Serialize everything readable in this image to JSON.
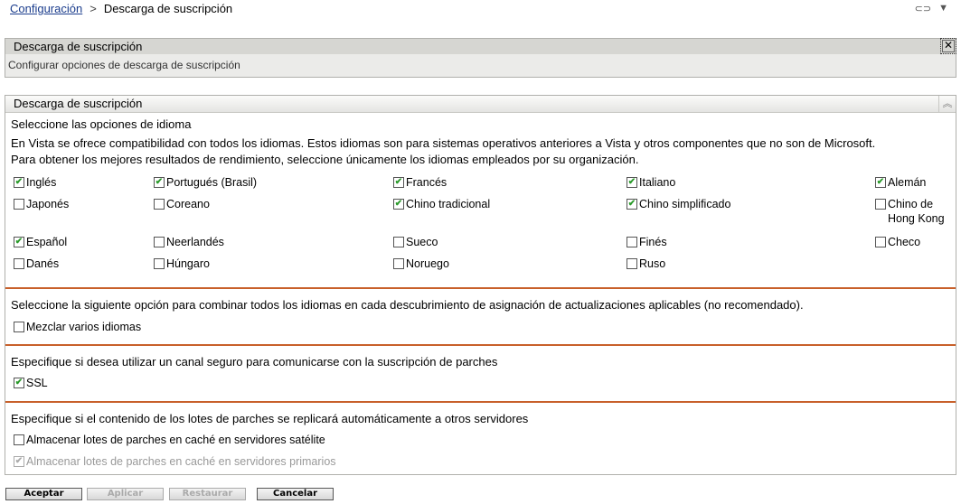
{
  "breadcrumb": {
    "parent": "Configuración",
    "current": "Descarga de suscripción"
  },
  "panel1": {
    "title": "Descarga de suscripción",
    "description": "Configurar opciones de descarga de suscripción"
  },
  "panel2": {
    "title": "Descarga de suscripción",
    "lang_heading": "Seleccione las opciones de idioma",
    "lang_note": "En Vista se ofrece compatibilidad con todos los idiomas. Estos idiomas son para sistemas operativos anteriores a Vista y otros componentes que no son de Microsoft. Para obtener los mejores resultados de rendimiento, seleccione únicamente los idiomas empleados por su organización.",
    "languages": [
      {
        "label": "Inglés",
        "checked": true
      },
      {
        "label": "Portugués (Brasil)",
        "checked": true
      },
      {
        "label": "Francés",
        "checked": true
      },
      {
        "label": "Italiano",
        "checked": true
      },
      {
        "label": "Alemán",
        "checked": true
      },
      {
        "label": "Japonés",
        "checked": false
      },
      {
        "label": "Coreano",
        "checked": false
      },
      {
        "label": "Chino tradicional",
        "checked": true
      },
      {
        "label": "Chino simplificado",
        "checked": true
      },
      {
        "label": "Chino de Hong Kong",
        "checked": false
      },
      {
        "label": "Español",
        "checked": true
      },
      {
        "label": "Neerlandés",
        "checked": false
      },
      {
        "label": "Sueco",
        "checked": false
      },
      {
        "label": "Finés",
        "checked": false
      },
      {
        "label": "Checo",
        "checked": false
      },
      {
        "label": "Danés",
        "checked": false
      },
      {
        "label": "Húngaro",
        "checked": false
      },
      {
        "label": "Noruego",
        "checked": false
      },
      {
        "label": "Ruso",
        "checked": false
      }
    ],
    "mix_heading": "Seleccione la siguiente opción para combinar todos los idiomas en cada descubrimiento de asignación de actualizaciones aplicables (no recomendado).",
    "mix_label": "Mezclar varios idiomas",
    "ssl_heading": "Especifique si desea utilizar un canal seguro para comunicarse con la suscripción de parches",
    "ssl_label": "SSL",
    "rep_heading": "Especifique si el contenido de los lotes de parches se replicará automáticamente a otros servidores",
    "rep_satellite": "Almacenar lotes de parches en caché en servidores satélite",
    "rep_primary": "Almacenar lotes de parches en caché en servidores primarios"
  },
  "buttons": {
    "accept": "Aceptar",
    "apply": "Aplicar",
    "restore": "Restaurar",
    "cancel": "Cancelar"
  },
  "colors": {
    "separator": "#c8602a",
    "check": "#2a9a2a"
  }
}
